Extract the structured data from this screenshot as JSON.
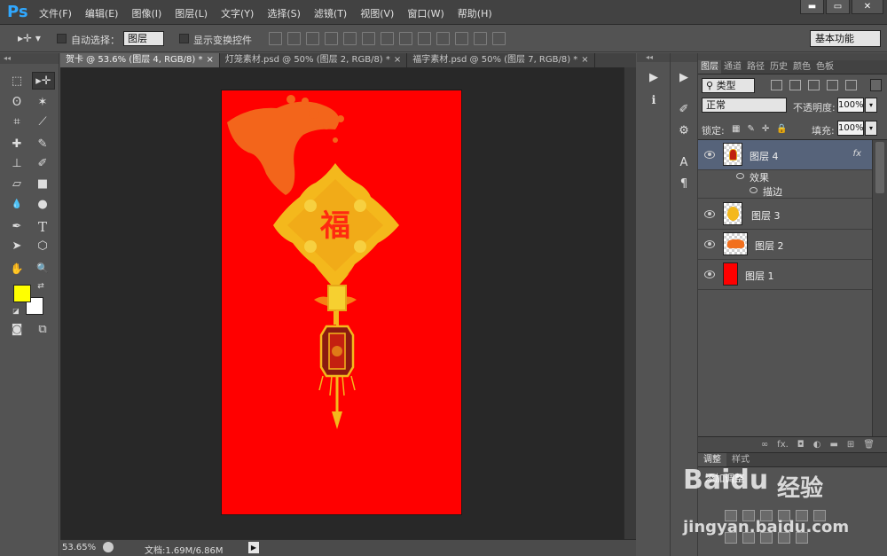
{
  "app": {
    "logo": "Ps"
  },
  "menu": [
    "文件(F)",
    "编辑(E)",
    "图像(I)",
    "图层(L)",
    "文字(Y)",
    "选择(S)",
    "滤镜(T)",
    "视图(V)",
    "窗口(W)",
    "帮助(H)"
  ],
  "window_buttons": [
    "▬",
    "▭",
    "✕"
  ],
  "options_bar": {
    "tool_glyph": "▸✛ ▾",
    "auto_select_label": "自动选择：",
    "auto_select_value": "图层",
    "show_transform_label": "显示变换控件",
    "workspace": "基本功能"
  },
  "toolbox_grip": "◂◂",
  "tools": [
    {
      "name": "rectangular-marquee-tool-icon",
      "glyph": "⬚"
    },
    {
      "name": "move-tool-icon",
      "glyph": "▸✛"
    },
    {
      "name": "lasso-tool-icon",
      "glyph": "ʘ"
    },
    {
      "name": "magic-wand-tool-icon",
      "glyph": "✶"
    },
    {
      "name": "crop-tool-icon",
      "glyph": "⌗"
    },
    {
      "name": "eyedropper-tool-icon",
      "glyph": "⟋"
    },
    {
      "name": "healing-brush-tool-icon",
      "glyph": "✚"
    },
    {
      "name": "brush-tool-icon",
      "glyph": "✎"
    },
    {
      "name": "clone-stamp-tool-icon",
      "glyph": "⊥"
    },
    {
      "name": "history-brush-tool-icon",
      "glyph": "✐"
    },
    {
      "name": "eraser-tool-icon",
      "glyph": "▱"
    },
    {
      "name": "gradient-tool-icon",
      "glyph": "■"
    },
    {
      "name": "blur-tool-icon",
      "glyph": "💧"
    },
    {
      "name": "dodge-tool-icon",
      "glyph": "●"
    },
    {
      "name": "pen-tool-icon",
      "glyph": "✒"
    },
    {
      "name": "type-tool-icon",
      "glyph": "T"
    },
    {
      "name": "path-selection-tool-icon",
      "glyph": "➤"
    },
    {
      "name": "shape-tool-icon",
      "glyph": "⬡"
    },
    {
      "name": "hand-tool-icon",
      "glyph": "✋"
    },
    {
      "name": "zoom-tool-icon",
      "glyph": "🔍"
    }
  ],
  "colors": {
    "foreground": "#ffff00",
    "background": "#ffffff",
    "canvas": "#ff0000"
  },
  "tabs": [
    {
      "label": "贺卡 @ 53.6% (图层 4, RGB/8) *",
      "close": "×",
      "active": true
    },
    {
      "label": "灯笼素材.psd @ 50% (图层 2, RGB/8) *",
      "close": "×",
      "active": false
    },
    {
      "label": "福字素材.psd @ 50% (图层 7, RGB/8) *",
      "close": "×",
      "active": false
    }
  ],
  "status": {
    "zoom": "53.65%",
    "doc_info": "文档:1.69M/6.86M",
    "arrow": "▶"
  },
  "canvas_art": {
    "fu_character": "福"
  },
  "mini_panel": {
    "grip": "◂◂",
    "buttons": [
      {
        "name": "history-play-icon",
        "glyph": "▶"
      },
      {
        "name": "info-icon",
        "glyph": "ℹ"
      },
      {
        "name": "brush-preset-icon",
        "glyph": "✐"
      },
      {
        "name": "tool-preset-icon",
        "glyph": "⚙"
      },
      {
        "name": "character-icon",
        "glyph": "A"
      },
      {
        "name": "paragraph-icon",
        "glyph": "¶"
      }
    ]
  },
  "layers_panel": {
    "tabs": [
      "图层",
      "通道",
      "路径",
      "历史",
      "颜色",
      "色板"
    ],
    "filter_type": "类型",
    "blend_mode": "正常",
    "opacity_label": "不透明度:",
    "opacity_value": "100%",
    "lock_label": "锁定:",
    "lock_icons": [
      "▦",
      "✎",
      "✛",
      "🔒"
    ],
    "fill_label": "填充:",
    "fill_value": "100%",
    "layers": [
      {
        "name": "图层 4",
        "selected": true,
        "fx": "fx",
        "effects_label": "效果",
        "effect": "描边"
      },
      {
        "name": "图层 3",
        "selected": false
      },
      {
        "name": "图层 2",
        "selected": false
      },
      {
        "name": "图层 1",
        "selected": false
      }
    ],
    "footer_icons": [
      "∞",
      "fx.",
      "◘",
      "◐",
      "▬",
      "⊞",
      "🗑"
    ]
  },
  "adjustments_panel": {
    "tabs": [
      "调整",
      "样式"
    ],
    "title": "添加调整"
  },
  "watermark": {
    "brand": "Baidu",
    "brand_cn": "经验",
    "url": "jingyan.baidu.com"
  }
}
